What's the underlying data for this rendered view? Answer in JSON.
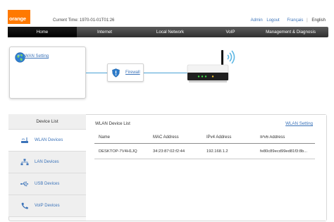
{
  "header": {
    "logo_text": "orange",
    "current_time": "Current Time: 1970-01-01T01:26",
    "links": {
      "admin": "Admin",
      "logout": "Logout",
      "lang_fr": "Français",
      "separator": "|",
      "lang_en": "English"
    }
  },
  "nav": [
    {
      "label": "Home"
    },
    {
      "label": "Internet"
    },
    {
      "label": "Local Network"
    },
    {
      "label": "VoIP"
    },
    {
      "label": "Management & Diagnosis"
    }
  ],
  "topology": {
    "wan_link": "WAN Setting",
    "firewall_link": "Firewall"
  },
  "device_list": {
    "title": "Device List",
    "items": [
      {
        "label": "WLAN Devices",
        "icon": "wifi-icon"
      },
      {
        "label": "LAN Devices",
        "icon": "network-icon"
      },
      {
        "label": "USB Devices",
        "icon": "usb-icon"
      },
      {
        "label": "VoIP Devices",
        "icon": "phone-icon"
      }
    ]
  },
  "wlan": {
    "title": "WLAN Device List",
    "setting_link": "WLAN Setting",
    "columns": [
      "Name",
      "MAC Address",
      "IPv4 Address",
      "IPv6 Address"
    ],
    "rows": [
      [
        "DESKTOP-7V4H1JQ",
        "34:23:87:02:f2:44",
        "192.168.1.2",
        "fe80c89ecd99ed81f3:8b..."
      ]
    ]
  },
  "colors": {
    "brand": "#ff7900",
    "link": "#3b73b9",
    "accent_line": "#4aa2d6"
  }
}
